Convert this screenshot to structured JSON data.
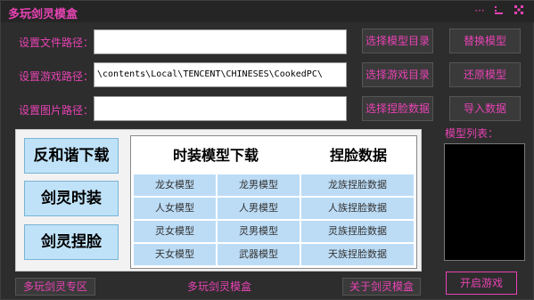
{
  "window": {
    "title": "多玩剑灵模盒",
    "accent_color": "#e843b4",
    "controls": [
      "menu-icon",
      "minimize-icon",
      "close-icon"
    ]
  },
  "paths": [
    {
      "label": "设置文件路径：",
      "value": ""
    },
    {
      "label": "设置游戏路径：",
      "value": "\\contents\\Local\\TENCENT\\CHINESES\\CookedPC\\"
    },
    {
      "label": "设置图片路径：",
      "value": ""
    }
  ],
  "actions": {
    "select_model_dir": "选择模型目录",
    "select_game_dir": "选择游戏目录",
    "select_face_data": "选择捏脸数据",
    "replace_model": "替换模型",
    "restore_model": "还原模型",
    "import_data": "导入数据"
  },
  "left_buttons": {
    "anti_censor": "反和谐下载",
    "costume": "剑灵时装",
    "face": "剑灵捏脸"
  },
  "table": {
    "headers": [
      "时装模型下载",
      "捏脸数据"
    ],
    "rows": [
      [
        "龙女模型",
        "龙男模型",
        "龙族捏脸数据"
      ],
      [
        "人女模型",
        "人男模型",
        "人族捏脸数据"
      ],
      [
        "灵女模型",
        "灵男模型",
        "灵族捏脸数据"
      ],
      [
        "天女模型",
        "武器模型",
        "天族捏脸数据"
      ]
    ]
  },
  "model_list": {
    "label": "模型列表："
  },
  "footer": {
    "zone_button": "多玩剑灵专区",
    "center_text": "多玩剑灵模盒",
    "about_button": "关于剑灵模盒",
    "start_button": "开启游戏"
  }
}
